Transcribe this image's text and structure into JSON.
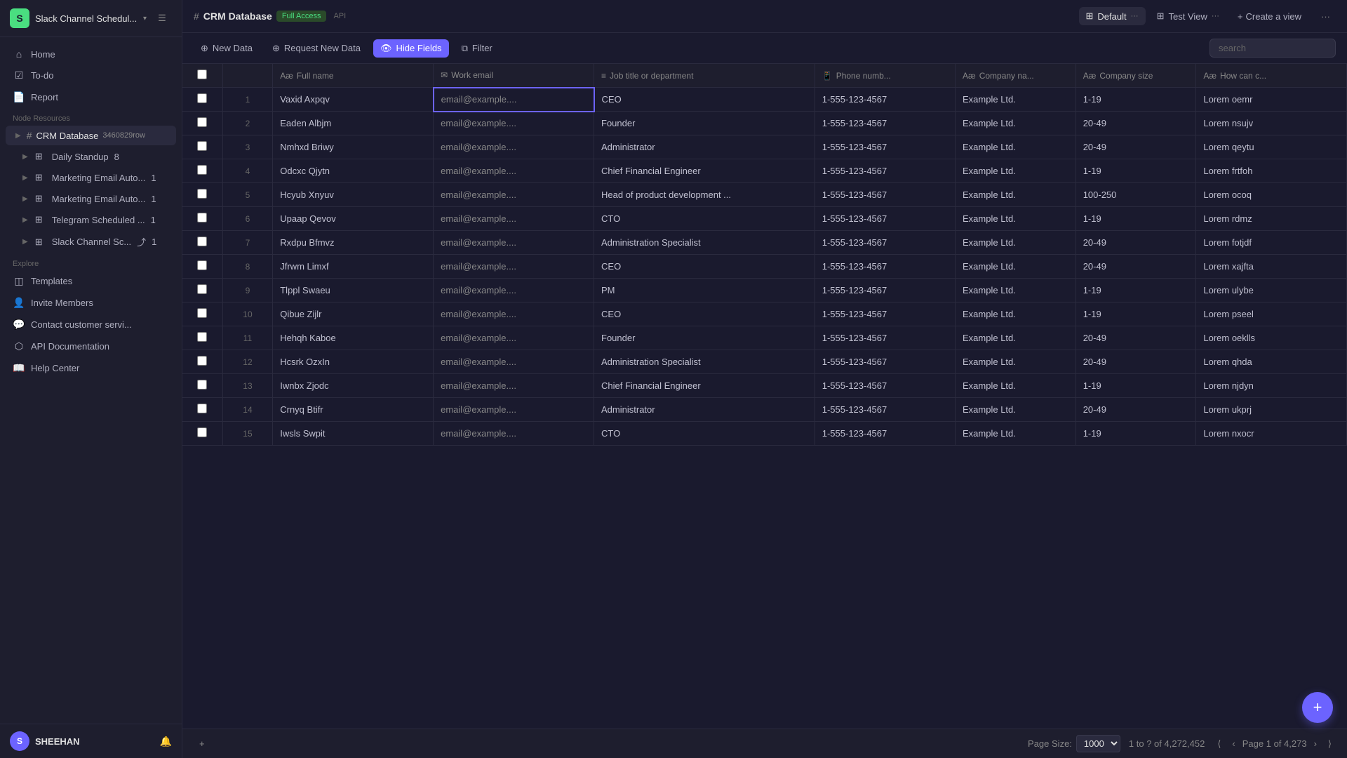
{
  "sidebar": {
    "logo_letter": "S",
    "app_title": "Slack Channel Schedul...",
    "nav": {
      "home": "Home",
      "todo": "To-do",
      "report": "Report"
    },
    "node_resources_label": "Node Resources",
    "crm_db": {
      "label": "CRM Database",
      "count": "3460829row"
    },
    "items": [
      {
        "label": "Daily Standup",
        "badge": "8"
      },
      {
        "label": "Marketing Email Auto...",
        "badge": "1"
      },
      {
        "label": "Marketing Email Auto...",
        "badge": "1"
      },
      {
        "label": "Telegram Scheduled ...",
        "badge": "1"
      },
      {
        "label": "Slack Channel Sc...",
        "badge": "1",
        "share": true
      }
    ],
    "explore_label": "Explore",
    "explore_items": [
      {
        "label": "Templates"
      },
      {
        "label": "Invite Members"
      },
      {
        "label": "Contact customer servi..."
      },
      {
        "label": "API Documentation"
      },
      {
        "label": "Help Center"
      }
    ],
    "user": {
      "name": "SHEEHAN",
      "initials": "S"
    }
  },
  "topbar": {
    "db_name": "CRM Database",
    "access_badge": "Full Access",
    "api_label": "API",
    "views": [
      {
        "label": "Default",
        "icon": "⊞",
        "active": true
      },
      {
        "label": "Test View",
        "icon": "⊞"
      }
    ],
    "create_view": "Create a view",
    "more_dots": "···"
  },
  "toolbar": {
    "new_data": "New Data",
    "request_new_data": "Request New Data",
    "hide_fields": "Hide Fields",
    "filter": "Filter",
    "search_placeholder": "search"
  },
  "table": {
    "columns": [
      {
        "label": "Full name",
        "icon": "Aæ"
      },
      {
        "label": "Work email",
        "icon": "✉"
      },
      {
        "label": "Job title or department",
        "icon": "≡"
      },
      {
        "label": "Phone numb...",
        "icon": "📱"
      },
      {
        "label": "Company na...",
        "icon": "Aæ"
      },
      {
        "label": "Company size",
        "icon": "Aæ"
      },
      {
        "label": "How can c...",
        "icon": "Aæ"
      }
    ],
    "rows": [
      {
        "num": 1,
        "name": "Vaxid Axpqv",
        "email": "email@example....",
        "job": "CEO",
        "phone": "1-555-123-4567",
        "company": "Example Ltd.",
        "size": "1-19",
        "how": "Lorem oemr"
      },
      {
        "num": 2,
        "name": "Eaden Albjm",
        "email": "email@example....",
        "job": "Founder",
        "phone": "1-555-123-4567",
        "company": "Example Ltd.",
        "size": "20-49",
        "how": "Lorem nsujv"
      },
      {
        "num": 3,
        "name": "Nmhxd Briwy",
        "email": "email@example....",
        "job": "Administrator",
        "phone": "1-555-123-4567",
        "company": "Example Ltd.",
        "size": "20-49",
        "how": "Lorem qeytu"
      },
      {
        "num": 4,
        "name": "Odcxc Qjytn",
        "email": "email@example....",
        "job": "Chief Financial Engineer",
        "phone": "1-555-123-4567",
        "company": "Example Ltd.",
        "size": "1-19",
        "how": "Lorem frtfoh"
      },
      {
        "num": 5,
        "name": "Hcyub Xnyuv",
        "email": "email@example....",
        "job": "Head of product development ...",
        "phone": "1-555-123-4567",
        "company": "Example Ltd.",
        "size": "100-250",
        "how": "Lorem ocoq"
      },
      {
        "num": 6,
        "name": "Upaap Qevov",
        "email": "email@example....",
        "job": "CTO",
        "phone": "1-555-123-4567",
        "company": "Example Ltd.",
        "size": "1-19",
        "how": "Lorem rdmz"
      },
      {
        "num": 7,
        "name": "Rxdpu Bfmvz",
        "email": "email@example....",
        "job": "Administration Specialist",
        "phone": "1-555-123-4567",
        "company": "Example Ltd.",
        "size": "20-49",
        "how": "Lorem fotjdf"
      },
      {
        "num": 8,
        "name": "Jfrwm Limxf",
        "email": "email@example....",
        "job": "CEO",
        "phone": "1-555-123-4567",
        "company": "Example Ltd.",
        "size": "20-49",
        "how": "Lorem xajfta"
      },
      {
        "num": 9,
        "name": "Tlppl Swaeu",
        "email": "email@example....",
        "job": "PM",
        "phone": "1-555-123-4567",
        "company": "Example Ltd.",
        "size": "1-19",
        "how": "Lorem ulybe"
      },
      {
        "num": 10,
        "name": "Qibue Zijlr",
        "email": "email@example....",
        "job": "CEO",
        "phone": "1-555-123-4567",
        "company": "Example Ltd.",
        "size": "1-19",
        "how": "Lorem pseel"
      },
      {
        "num": 11,
        "name": "Hehqh Kaboe",
        "email": "email@example....",
        "job": "Founder",
        "phone": "1-555-123-4567",
        "company": "Example Ltd.",
        "size": "20-49",
        "how": "Lorem oeklls"
      },
      {
        "num": 12,
        "name": "Hcsrk OzxIn",
        "email": "email@example....",
        "job": "Administration Specialist",
        "phone": "1-555-123-4567",
        "company": "Example Ltd.",
        "size": "20-49",
        "how": "Lorem qhda"
      },
      {
        "num": 13,
        "name": "Iwnbx Zjodc",
        "email": "email@example....",
        "job": "Chief Financial Engineer",
        "phone": "1-555-123-4567",
        "company": "Example Ltd.",
        "size": "1-19",
        "how": "Lorem njdyn"
      },
      {
        "num": 14,
        "name": "Crnyq Btifr",
        "email": "email@example....",
        "job": "Administrator",
        "phone": "1-555-123-4567",
        "company": "Example Ltd.",
        "size": "20-49",
        "how": "Lorem ukprj"
      },
      {
        "num": 15,
        "name": "Iwsls Swpit",
        "email": "email@example....",
        "job": "CTO",
        "phone": "1-555-123-4567",
        "company": "Example Ltd.",
        "size": "1-19",
        "how": "Lorem nxocr"
      }
    ]
  },
  "footer": {
    "page_size_label": "Page Size:",
    "page_size_value": "1000",
    "records_info": "1 to ? of 4,272,452",
    "page_info": "Page 1 of 4,273",
    "add_label": "+"
  }
}
